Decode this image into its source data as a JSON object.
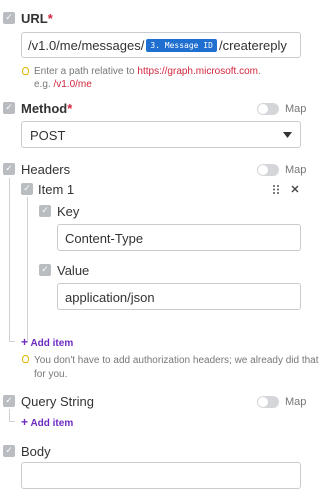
{
  "url": {
    "label": "URL",
    "required_mark": "*",
    "value_prefix": "/v1.0/me/messages/",
    "token": "3. Message ID",
    "value_suffix": "/createreply",
    "hint_prefix": "Enter a path relative to ",
    "hint_link": "https://graph.microsoft.com",
    "hint_dot": ".",
    "hint_eg_prefix": "e.g. ",
    "hint_eg_value": "/v1.0/me"
  },
  "method": {
    "label": "Method",
    "required_mark": "*",
    "map_label": "Map",
    "value": "POST"
  },
  "headers": {
    "label": "Headers",
    "map_label": "Map",
    "item_title": "Item 1",
    "key_label": "Key",
    "key_value": "Content-Type",
    "value_label": "Value",
    "value_value": "application/json",
    "add_item": "Add item",
    "note_line1": "You don't have to add authorization headers; we already did that",
    "note_line2": "for you."
  },
  "query_string": {
    "label": "Query String",
    "map_label": "Map",
    "add_item": "Add item"
  },
  "body": {
    "label": "Body",
    "value": ""
  },
  "colors": {
    "accent_purple": "#6d2bbf",
    "token_blue": "#1f6fd1",
    "required_red": "#d3263e",
    "checkbox_gray": "#b9bcc0"
  }
}
